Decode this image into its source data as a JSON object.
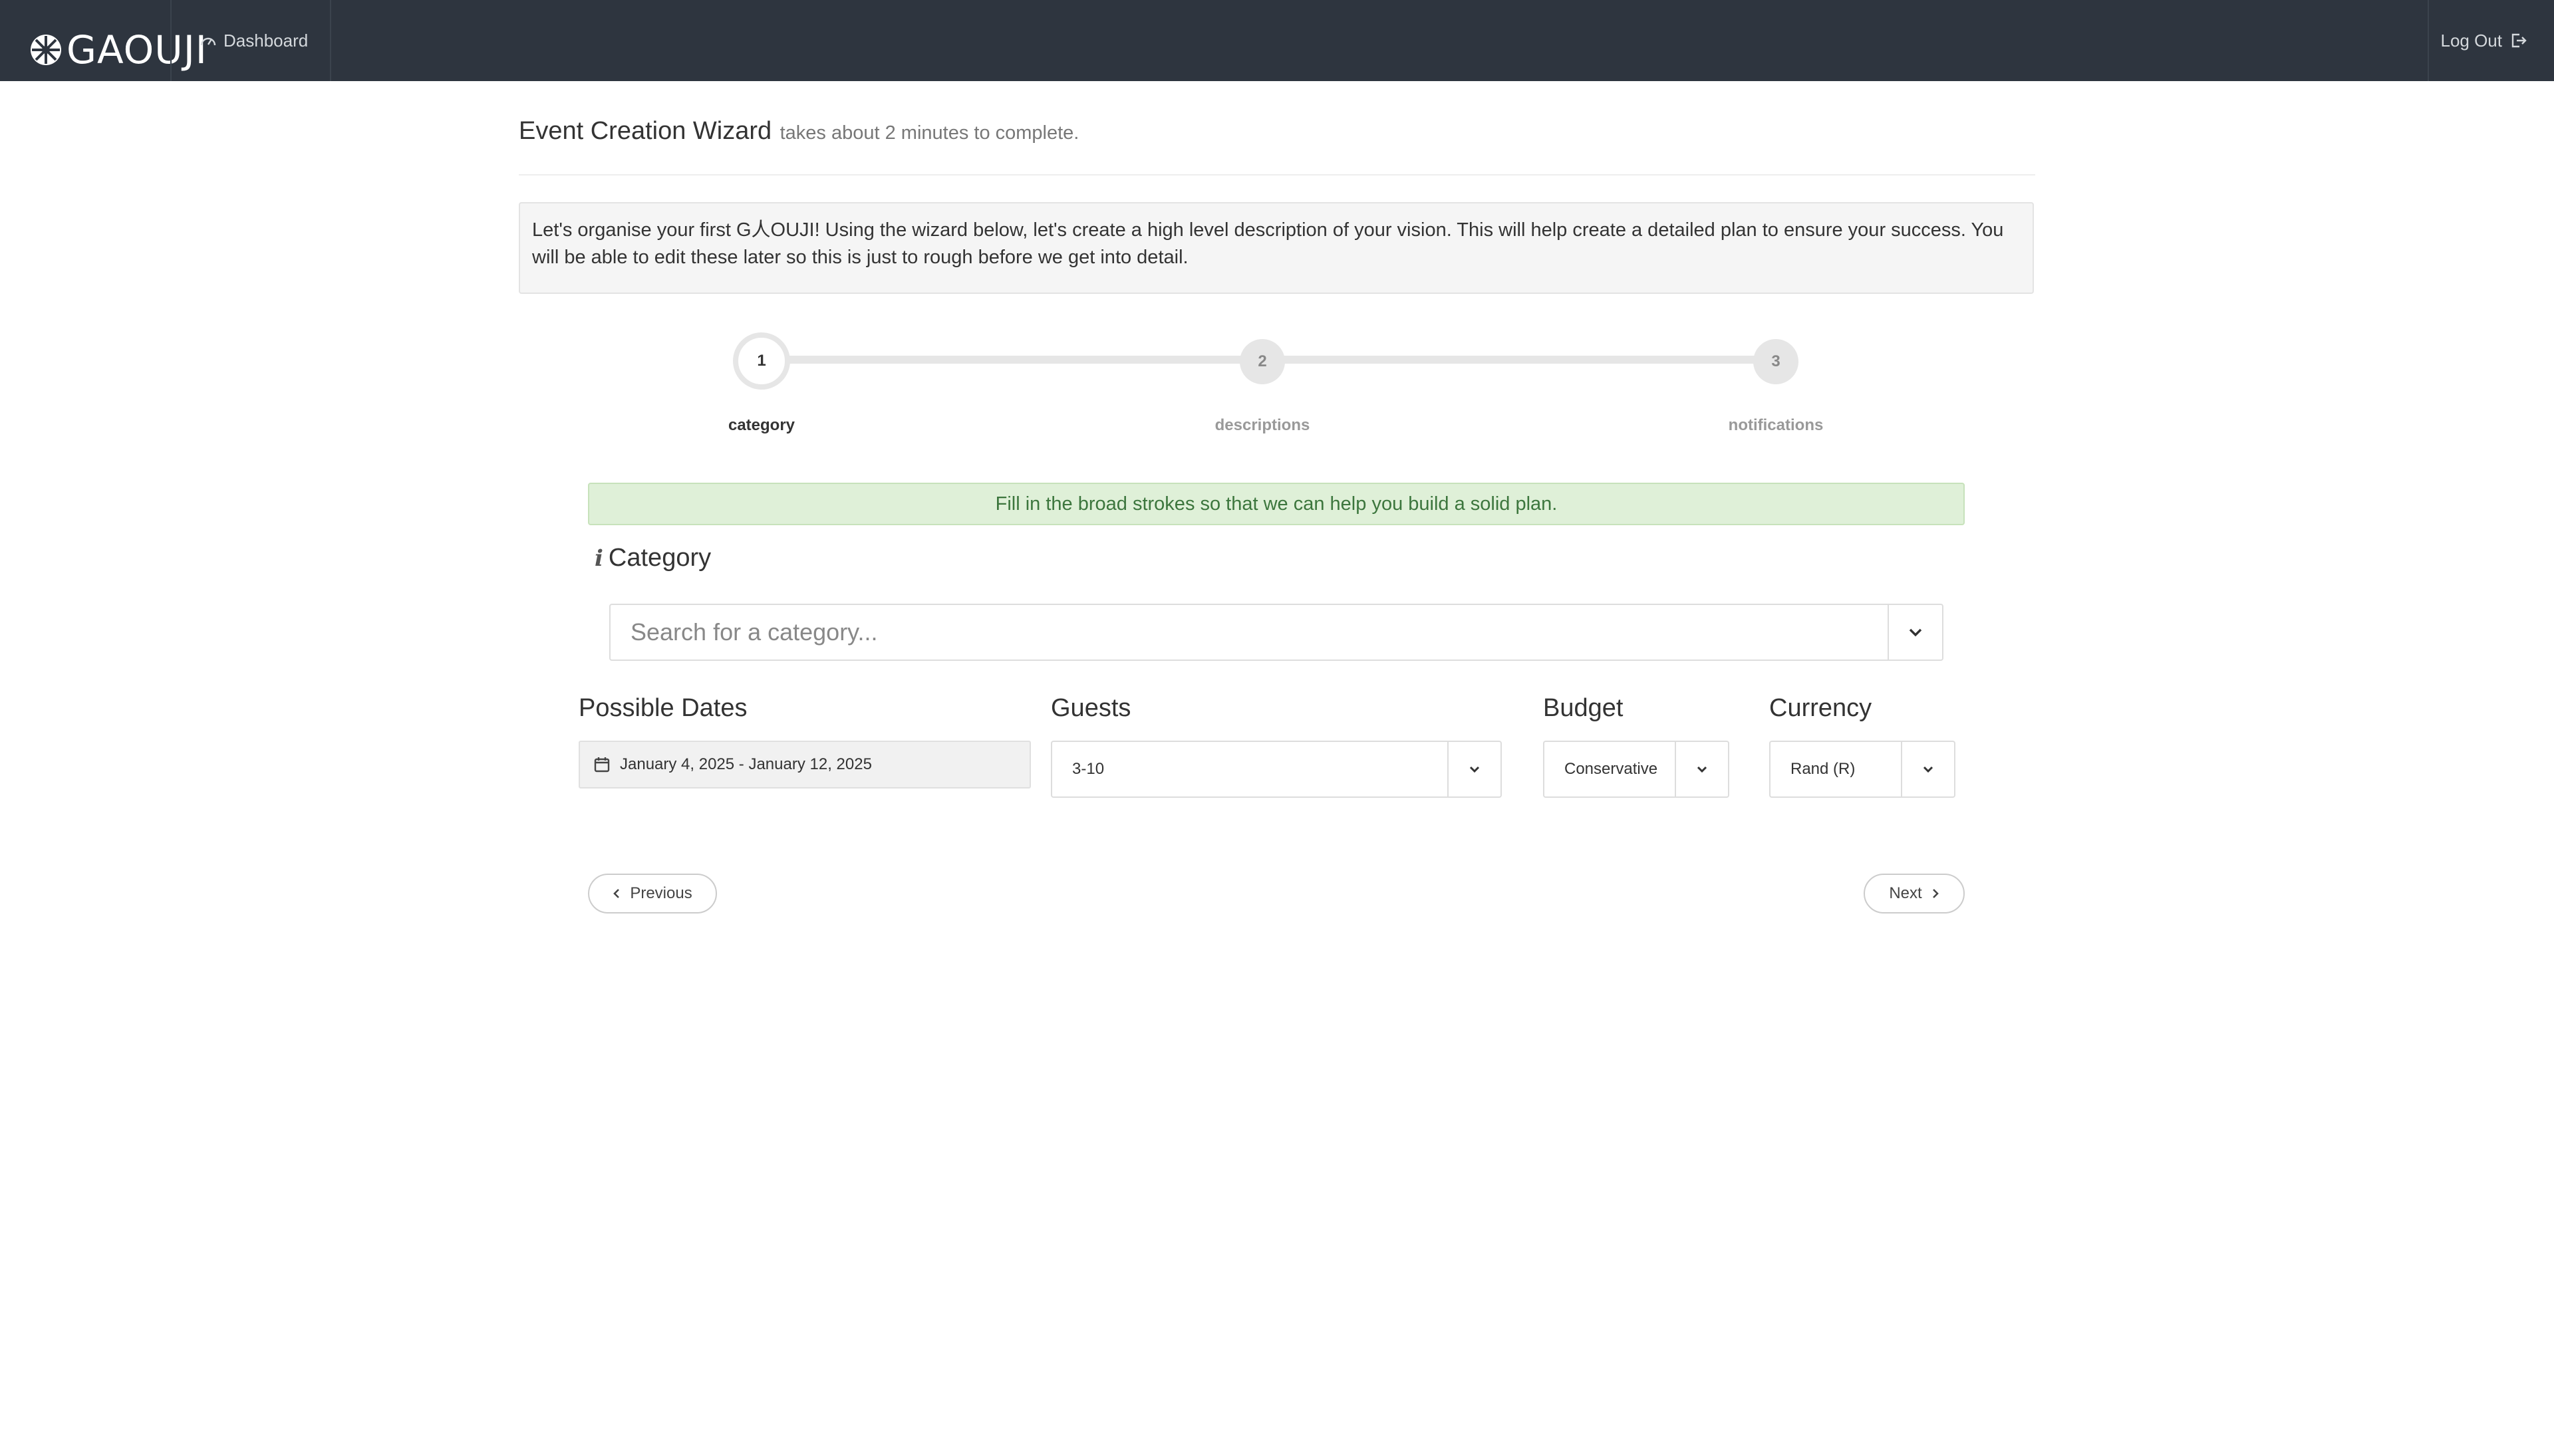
{
  "navbar": {
    "brand": "GAOUJI",
    "dashboard_label": "Dashboard",
    "logout_label": "Log Out"
  },
  "header": {
    "title": "Event Creation Wizard",
    "subtitle": "takes about 2 minutes to complete."
  },
  "intro": {
    "text": "Let's organise your first G人OUJI! Using the wizard below, let's create a high level description of your vision. This will help create a detailed plan to ensure your success. You will be able to edit these later so this is just to rough before we get into detail."
  },
  "stepper": {
    "steps": [
      {
        "number": "1",
        "label": "category",
        "active": true
      },
      {
        "number": "2",
        "label": "descriptions",
        "active": false
      },
      {
        "number": "3",
        "label": "notifications",
        "active": false
      }
    ]
  },
  "alert": {
    "text": "Fill in the broad strokes so that we can help you build a solid plan."
  },
  "category": {
    "heading": "Category",
    "info_icon": "i",
    "search_placeholder": "Search for a category..."
  },
  "fields": {
    "dates": {
      "label": "Possible Dates",
      "value": "January 4, 2025 - January 12, 2025"
    },
    "guests": {
      "label": "Guests",
      "value": "3-10"
    },
    "budget": {
      "label": "Budget",
      "value": "Conservative"
    },
    "currency": {
      "label": "Currency",
      "value": "Rand (R)"
    }
  },
  "nav_buttons": {
    "previous": "Previous",
    "next": "Next"
  },
  "colors": {
    "navbar": "#2e353f",
    "alert_bg": "#dff0d8",
    "alert_text": "#3c763d",
    "intro_bg": "#f5f5f5"
  }
}
